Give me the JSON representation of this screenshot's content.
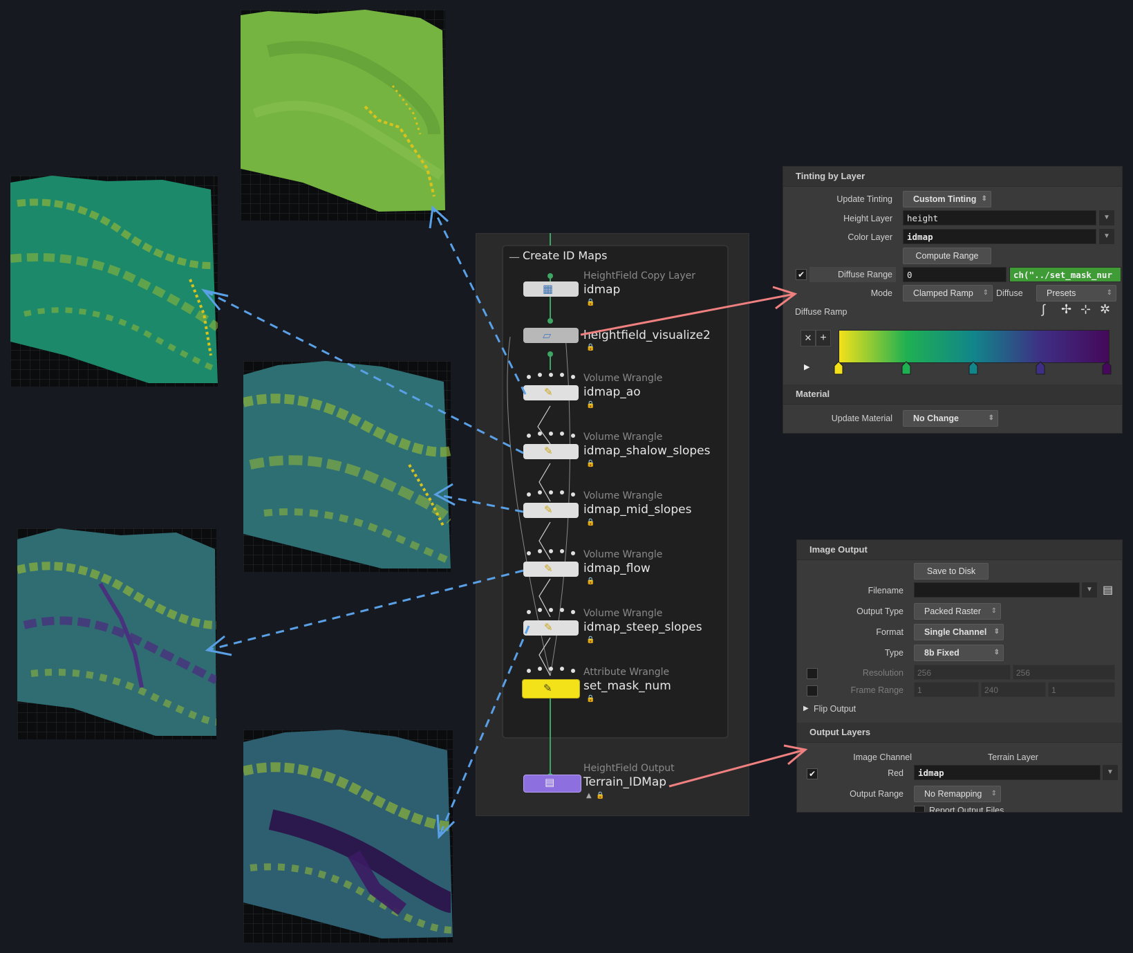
{
  "network": {
    "title": "Create ID Maps",
    "nodes": [
      {
        "type": "HeightField Copy Layer",
        "name": "idmap"
      },
      {
        "type": "",
        "name": "heightfield_visualize2"
      },
      {
        "type": "Volume Wrangle",
        "name": "idmap_ao"
      },
      {
        "type": "Volume Wrangle",
        "name": "idmap_shalow_slopes"
      },
      {
        "type": "Volume Wrangle",
        "name": "idmap_mid_slopes"
      },
      {
        "type": "Volume Wrangle",
        "name": "idmap_flow"
      },
      {
        "type": "Volume Wrangle",
        "name": "idmap_steep_slopes"
      },
      {
        "type": "Attribute Wrangle",
        "name": "set_mask_num"
      },
      {
        "type": "HeightField Output",
        "name": "Terrain_IDMap"
      }
    ]
  },
  "tinting": {
    "section_title": "Tinting by Layer",
    "update_tinting_label": "Update Tinting",
    "update_tinting_value": "Custom Tinting",
    "height_layer_label": "Height Layer",
    "height_layer_value": "height",
    "color_layer_label": "Color Layer",
    "color_layer_value": "idmap",
    "compute_range_button": "Compute Range",
    "diffuse_range_label": "Diffuse Range",
    "diffuse_range_min": "0",
    "diffuse_range_expr": "ch(\"../set_mask_nur",
    "mode_label": "Mode",
    "mode_value": "Clamped Ramp",
    "diffuse_label": "Diffuse",
    "presets_label": "Presets",
    "diffuse_ramp_label": "Diffuse Ramp",
    "ramp_colors": [
      "#f2e11a",
      "#1fb052",
      "#11858a",
      "#3e2f84",
      "#45085a"
    ],
    "material_section_title": "Material",
    "update_material_label": "Update Material",
    "update_material_value": "No Change"
  },
  "image_output": {
    "section_title": "Image Output",
    "save_to_disk_button": "Save to Disk",
    "filename_label": "Filename",
    "filename_value": "",
    "output_type_label": "Output Type",
    "output_type_value": "Packed Raster",
    "format_label": "Format",
    "format_value": "Single Channel",
    "type_label": "Type",
    "type_value": "8b Fixed",
    "resolution_label": "Resolution",
    "resolution_x": "256",
    "resolution_y": "256",
    "frame_range_label": "Frame Range",
    "frame_start": "1",
    "frame_end": "240",
    "frame_inc": "1",
    "flip_output_label": "Flip Output",
    "output_layers_title": "Output Layers",
    "image_channel_header": "Image Channel",
    "terrain_layer_header": "Terrain Layer",
    "red_label": "Red",
    "red_value": "idmap",
    "output_range_label": "Output Range",
    "output_range_value": "No Remapping",
    "report_output_label": "Report Output Files"
  }
}
